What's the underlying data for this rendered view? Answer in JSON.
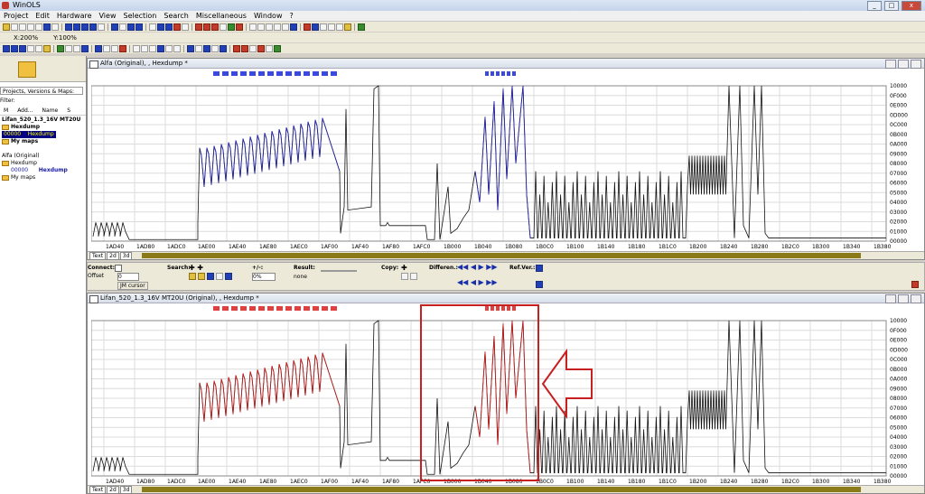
{
  "app": {
    "title": "WinOLS"
  },
  "menu": [
    "Project",
    "Edit",
    "Hardware",
    "View",
    "Selection",
    "Search",
    "Miscellaneous",
    "Window",
    "?"
  ],
  "toolbar": {
    "zoom_x": "X:200%",
    "zoom_y": "Y:100%"
  },
  "left_pane": {
    "dropdown": "Projects, Versions & Maps:",
    "filter_label": "Filter:",
    "columns": [
      "M",
      "Add...",
      "Name",
      "S"
    ],
    "project": "Lifan_520_1.3_16V MT20U",
    "tree_hexdump": "Hexdump",
    "tree_sel_addr": "00000",
    "tree_sel_name": "Hexdump",
    "tree_mymaps": "My maps",
    "version": "Alfa (Original)",
    "v_hexdump": "Hexdump",
    "v_addr": "00000",
    "v_name": "Hexdump",
    "v_mymaps": "My maps"
  },
  "windows": {
    "top_title": "Alfa (Original), , Hexdump *",
    "bottom_title": "Lifan_520_1.3_16V MT20U (Original), , Hexdump *"
  },
  "x_ticks": [
    "1AD40",
    "1AD80",
    "1ADC0",
    "1AE00",
    "1AE40",
    "1AE80",
    "1AEC0",
    "1AF00",
    "1AF40",
    "1AF80",
    "1AFC0",
    "1B000",
    "1B040",
    "1B080",
    "1B0C0",
    "1B100",
    "1B140",
    "1B180",
    "1B1C0",
    "1B200",
    "1B240",
    "1B280",
    "1B2C0",
    "1B300",
    "1B340",
    "1B380"
  ],
  "y_ticks": [
    "10000",
    "0F000",
    "0E000",
    "0D000",
    "0C000",
    "0B000",
    "0A000",
    "09000",
    "08000",
    "07000",
    "06000",
    "05000",
    "04000",
    "03000",
    "02000",
    "01000",
    "00000"
  ],
  "tabs": [
    "Text",
    "2d",
    "3d"
  ],
  "mid": {
    "connect": "Connect:",
    "offset": "Offset",
    "offset_val": "0",
    "jm_cursor": "JM cursor",
    "search": "Search:",
    "plusminus": "+/-:",
    "pct": "0%",
    "result": "Result:",
    "result_val": "none",
    "copy": "Copy:",
    "differen": "Differen.:",
    "refver": "Ref.Ver.:"
  },
  "colors": {
    "top_trace": "#2a2aa8",
    "bottom_trace": "#c02020",
    "marker_top": "#3a4adf",
    "marker_bottom": "#e04040",
    "highlight": "#c82020"
  }
}
